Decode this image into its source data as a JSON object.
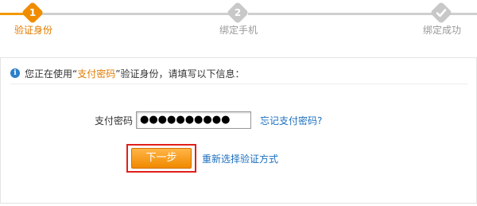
{
  "steps": [
    {
      "number": "1",
      "label": "验证身份",
      "state": "active"
    },
    {
      "number": "2",
      "label": "绑定手机",
      "state": "pending"
    },
    {
      "number": "",
      "label": "绑定成功",
      "state": "pending"
    }
  ],
  "colors": {
    "active": "#f08c00",
    "inactive": "#c8c8c8",
    "link": "#1c6fbf",
    "highlight_border": "#e0201a"
  },
  "notice": {
    "icon": "info-icon",
    "prefix": "您正在使用“",
    "highlight": "支付密码",
    "suffix": "”验证身份，请填写以下信息："
  },
  "form": {
    "password_label": "支付密码",
    "password_value": "●●●●●●●●●●",
    "forgot_link": "忘记支付密码?",
    "next_button": "下一步",
    "reselect_link": "重新选择验证方式"
  }
}
